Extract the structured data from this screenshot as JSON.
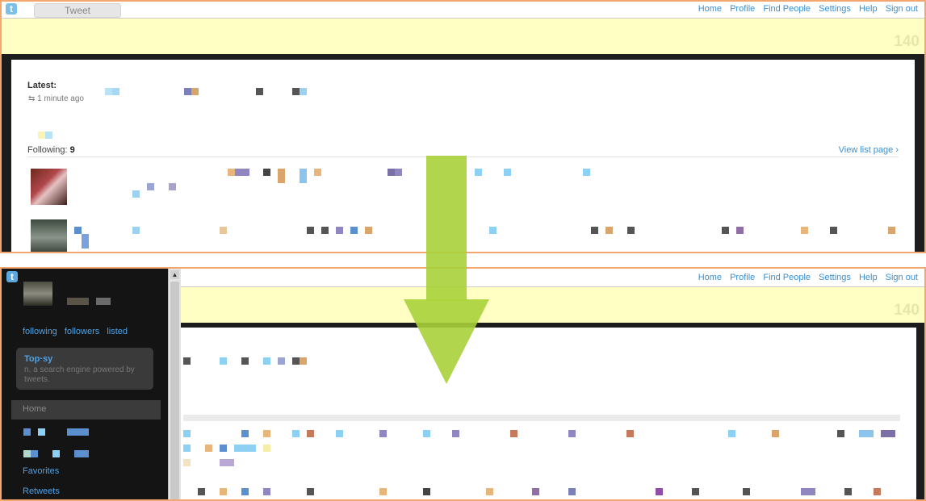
{
  "top": {
    "tweet_button": "Tweet",
    "nav": [
      "Home",
      "Profile",
      "Find People",
      "Settings",
      "Help",
      "Sign out"
    ],
    "char_count": "140",
    "latest_label": "Latest:",
    "latest_time": "1 minute ago",
    "following_label": "Following:",
    "following_count": "9",
    "view_list": "View list page ›"
  },
  "bottom": {
    "nav": [
      "Home",
      "Profile",
      "Find People",
      "Settings",
      "Help",
      "Sign out"
    ],
    "char_count": "140",
    "sidebar": {
      "stats": [
        "following",
        "followers",
        "listed"
      ],
      "topsy_title": "Top·sy",
      "topsy_desc": "n. a search engine powered by tweets.",
      "home_label": "Home",
      "favorites": "Favorites",
      "retweets": "Retweets"
    }
  },
  "colors": {
    "panel_border": "#f3a66e",
    "link": "#3a8fd1",
    "tweet_box": "#ffffc4",
    "arrow": "#a8d23a",
    "sidebar_bg": "#141414"
  },
  "icons": [
    "twitter-logo-icon",
    "down-arrow-icon",
    "retweet-icon"
  ]
}
